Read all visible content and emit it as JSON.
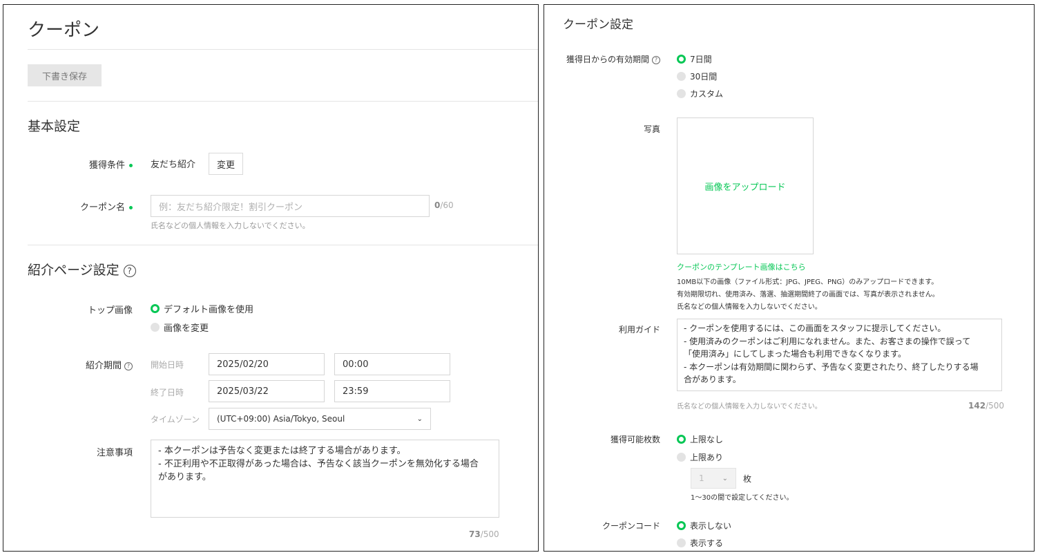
{
  "left": {
    "page_title": "クーポン",
    "draft_save": "下書き保存",
    "basic": {
      "heading": "基本設定",
      "acquire_label": "獲得条件",
      "acquire_value": "友だち紹介",
      "change_btn": "変更",
      "coupon_name_label": "クーポン名",
      "coupon_name_placeholder": "例：友だち紹介限定！割引クーポン",
      "coupon_name_count": "0",
      "coupon_name_max": "/60",
      "coupon_name_hint": "氏名などの個人情報を入力しないでください。"
    },
    "intro": {
      "heading": "紹介ページ設定",
      "top_image_label": "トップ画像",
      "top_image_options": [
        "デフォルト画像を使用",
        "画像を変更"
      ],
      "period_label": "紹介期間",
      "start_label": "開始日時",
      "start_date": "2025/02/20",
      "start_time": "00:00",
      "end_label": "終了日時",
      "end_date": "2025/03/22",
      "end_time": "23:59",
      "tz_label": "タイムゾーン",
      "tz_value": "(UTC+09:00) Asia/Tokyo, Seoul",
      "notes_label": "注意事項",
      "notes_lines": [
        "- 本クーポンは予告なく変更または終了する場合があります。",
        "- 不正利用や不正取得があった場合は、予告なく該当クーポンを無効化する場合",
        "があります。"
      ],
      "notes_count": "73",
      "notes_max": "/500"
    }
  },
  "right": {
    "heading": "クーポン設定",
    "validity_label": "獲得日からの有効期間",
    "validity_options": [
      "7日間",
      "30日間",
      "カスタム"
    ],
    "photo_label": "写真",
    "upload_text": "画像をアップロード",
    "template_link": "クーポンのテンプレート画像はこちら",
    "photo_notes": [
      "10MB以下の画像（ファイル形式：JPG、JPEG、PNG）のみアップロードできます。",
      "有効期限切れ、使用済み、落選、抽選期間終了の画面では、写真が表示されません。",
      "氏名などの個人情報を入力しないでください。"
    ],
    "guide_label": "利用ガイド",
    "guide_lines": [
      "- クーポンを使用するには、この画面をスタッフに提示してください。",
      "- 使用済みのクーポンはご利用になれません。また、お客さまの操作で誤って",
      "「使用済み」にしてしまった場合も利用できなくなります。",
      "- 本クーポンは有効期間に関わらず、予告なく変更されたり、終了したりする場",
      "合があります。"
    ],
    "guide_hint": "氏名などの個人情報を入力しないでください。",
    "guide_count": "142",
    "guide_max": "/500",
    "limit_label": "獲得可能枚数",
    "limit_options": [
      "上限なし",
      "上限あり"
    ],
    "limit_value": "1",
    "limit_unit": "枚",
    "limit_hint": "1～30の間で設定してください。",
    "code_label": "クーポンコード",
    "code_options": [
      "表示しない",
      "表示する"
    ]
  }
}
